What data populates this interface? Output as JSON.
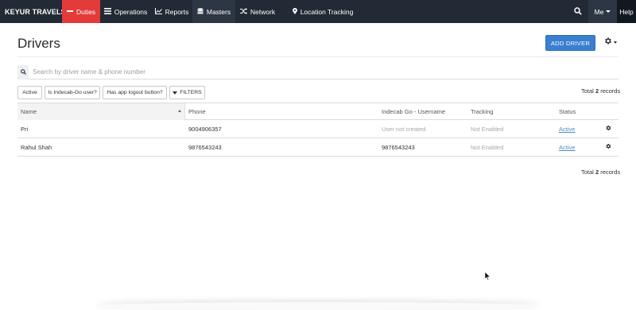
{
  "navbar": {
    "brand": "KEYUR TRAVELS",
    "items": [
      {
        "label": "Duties",
        "icon": "minus-icon"
      },
      {
        "label": "Operations",
        "icon": "list-icon"
      },
      {
        "label": "Reports",
        "icon": "line-chart-icon"
      },
      {
        "label": "Masters",
        "icon": "database-icon"
      },
      {
        "label": "Network",
        "icon": "shuffle-icon"
      },
      {
        "label": "Location Tracking",
        "icon": "map-marker-icon"
      }
    ],
    "me_label": "Me",
    "help_label": "Help",
    "active_color": "#e33a3a",
    "background_color": "#222a35"
  },
  "page": {
    "title": "Drivers",
    "add_button_label": "ADD DRIVER",
    "accent_color": "#3a7fd0"
  },
  "search": {
    "placeholder": "Search by driver name & phone number",
    "value": ""
  },
  "filters": {
    "chips": [
      "Active",
      "Is Indecab-Go user?",
      "Has app logout button?"
    ],
    "filters_label": "FILTERS"
  },
  "totals": {
    "prefix": "Total",
    "count": "2",
    "suffix": "records"
  },
  "table": {
    "columns": [
      "Name",
      "Phone",
      "Indecab Go - Username",
      "Tracking",
      "Status"
    ],
    "sort_column": "Name",
    "sort_direction": "ascending",
    "rows": [
      {
        "name": "Pri",
        "phone": "9004906357",
        "username": "User not created",
        "tracking": "Not Enabled",
        "status": "Active"
      },
      {
        "name": "Rahul Shah",
        "phone": "9876543243",
        "username": "9876543243",
        "tracking": "Not Enabled",
        "status": "Active"
      }
    ]
  }
}
